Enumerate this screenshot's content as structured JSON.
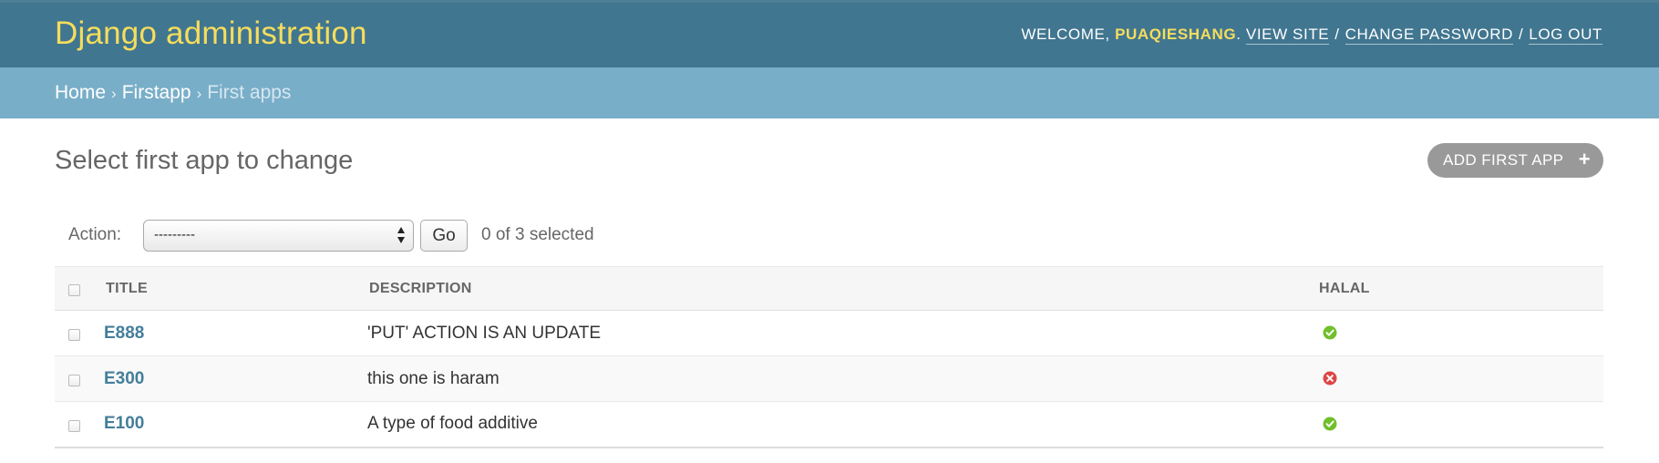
{
  "header": {
    "branding": "Django administration",
    "welcome": "WELCOME, ",
    "username": "PUAQIESHANG",
    "period": ".",
    "view_site": "VIEW SITE",
    "change_password": "CHANGE PASSWORD",
    "log_out": "LOG OUT",
    "separator": "/"
  },
  "breadcrumbs": {
    "home": "Home",
    "app": "Firstapp",
    "current": "First apps",
    "separator": "›"
  },
  "content": {
    "title": "Select first app to change",
    "add_button": "ADD FIRST APP",
    "add_icon": "plus-icon"
  },
  "actions": {
    "label": "Action:",
    "selected_option": "---------",
    "go": "Go",
    "counter": "0 of 3 selected"
  },
  "table": {
    "columns": [
      "TITLE",
      "DESCRIPTION",
      "HALAL"
    ],
    "rows": [
      {
        "title": "E888",
        "description": "'PUT' ACTION IS AN UPDATE",
        "halal": "yes-icon"
      },
      {
        "title": "E300",
        "description": "this one is haram",
        "halal": "no-icon"
      },
      {
        "title": "E100",
        "description": "A type of food additive",
        "halal": "yes-icon"
      }
    ]
  },
  "colors": {
    "header_bg": "#417690",
    "branding": "#f5dd5d",
    "breadcrumb_bg": "#79aec8",
    "link": "#447e9b",
    "yes": "#70bf2b",
    "no": "#dd4646"
  }
}
